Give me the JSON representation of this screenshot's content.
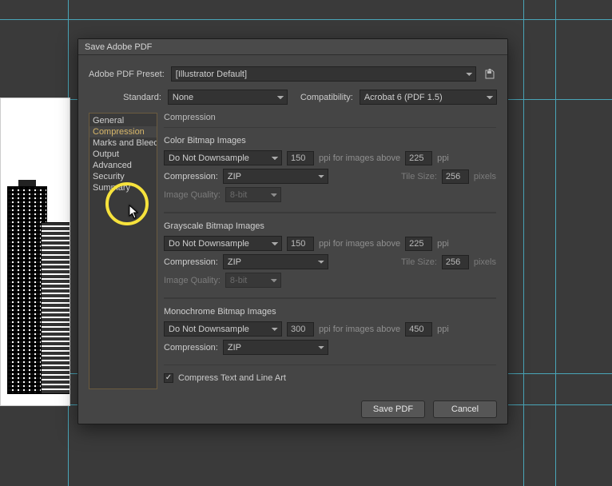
{
  "dialog": {
    "title": "Save Adobe PDF",
    "presetLabel": "Adobe PDF Preset:",
    "presetValue": "[Illustrator Default]",
    "standardLabel": "Standard:",
    "standardValue": "None",
    "compatLabel": "Compatibility:",
    "compatValue": "Acrobat 6 (PDF 1.5)"
  },
  "sidebar": {
    "items": [
      {
        "label": "General"
      },
      {
        "label": "Compression"
      },
      {
        "label": "Marks and Bleeds"
      },
      {
        "label": "Output"
      },
      {
        "label": "Advanced"
      },
      {
        "label": "Security"
      },
      {
        "label": "Summary"
      }
    ]
  },
  "panel": {
    "title": "Compression",
    "color": {
      "groupLabel": "Color Bitmap Images",
      "downsample": "Do Not Downsample",
      "ppi": "150",
      "ppiAboveLabel": "ppi for images above",
      "ppiAbove": "225",
      "ppiUnit": "ppi",
      "compLabel": "Compression:",
      "compValue": "ZIP",
      "tileLabel": "Tile Size:",
      "tileValue": "256",
      "pixelsUnit": "pixels",
      "iqLabel": "Image Quality:",
      "iqValue": "8-bit"
    },
    "gray": {
      "groupLabel": "Grayscale Bitmap Images",
      "downsample": "Do Not Downsample",
      "ppi": "150",
      "ppiAboveLabel": "ppi for images above",
      "ppiAbove": "225",
      "ppiUnit": "ppi",
      "compLabel": "Compression:",
      "compValue": "ZIP",
      "tileLabel": "Tile Size:",
      "tileValue": "256",
      "pixelsUnit": "pixels",
      "iqLabel": "Image Quality:",
      "iqValue": "8-bit"
    },
    "mono": {
      "groupLabel": "Monochrome Bitmap Images",
      "downsample": "Do Not Downsample",
      "ppi": "300",
      "ppiAboveLabel": "ppi for images above",
      "ppiAbove": "450",
      "ppiUnit": "ppi",
      "compLabel": "Compression:",
      "compValue": "ZIP"
    },
    "compressTextLabel": "Compress Text and Line Art"
  },
  "footer": {
    "save": "Save PDF",
    "cancel": "Cancel"
  }
}
